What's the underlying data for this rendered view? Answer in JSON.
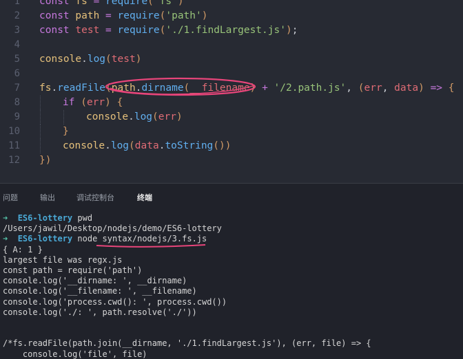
{
  "editor": {
    "lines": [
      {
        "num": "1",
        "text": "const fs = require('fs')"
      },
      {
        "num": "2",
        "text": "const path = require('path')"
      },
      {
        "num": "3",
        "text": "const test = require('./1.findLargest.js');"
      },
      {
        "num": "4",
        "text": ""
      },
      {
        "num": "5",
        "text": "console.log(test)"
      },
      {
        "num": "6",
        "text": ""
      },
      {
        "num": "7",
        "text": "fs.readFile(path.dirname(__filename) + '/2.path.js', (err, data) => {"
      },
      {
        "num": "8",
        "text": "if (err) {"
      },
      {
        "num": "9",
        "text": "console.log(err)"
      },
      {
        "num": "10",
        "text": "}"
      },
      {
        "num": "11",
        "text": "console.log(data.toString())"
      },
      {
        "num": "12",
        "text": "})"
      }
    ]
  },
  "panel": {
    "tabs": [
      {
        "label": "问题"
      },
      {
        "label": "输出"
      },
      {
        "label": "调试控制台"
      },
      {
        "label": "终端",
        "active": true
      }
    ]
  },
  "terminal": {
    "prompt_symbol": "➜",
    "lines": [
      {
        "type": "prompt",
        "dir": "ES6-lottery",
        "cmd": "pwd"
      },
      {
        "type": "out",
        "text": "/Users/jawil/Desktop/nodejs/demo/ES6-lottery"
      },
      {
        "type": "prompt",
        "dir": "ES6-lottery",
        "cmd": "node syntax/nodejs/3.fs.js"
      },
      {
        "type": "out",
        "text": "{ A: 1 }"
      },
      {
        "type": "out",
        "text": "largest file was regx.js"
      },
      {
        "type": "out",
        "text": "const path = require('path')"
      },
      {
        "type": "out",
        "text": "console.log('__dirname: ', __dirname)"
      },
      {
        "type": "out",
        "text": "console.log('__filename: ', __filename)"
      },
      {
        "type": "out",
        "text": "console.log('process.cwd(): ', process.cwd())"
      },
      {
        "type": "out",
        "text": "console.log('./: ', path.resolve('./'))"
      },
      {
        "type": "out",
        "text": ""
      },
      {
        "type": "out",
        "text": ""
      },
      {
        "type": "out",
        "text": "/*fs.readFile(path.join(__dirname, './1.findLargest.js'), (err, file) => {"
      },
      {
        "type": "out",
        "text": "    console.log('file', file)"
      },
      {
        "type": "out",
        "text": "})*/"
      }
    ]
  },
  "colors": {
    "editor_bg": "#272a33",
    "terminal_bg": "#20222a",
    "annotation": "#e8457a",
    "prompt_arrow": "#55c2a8",
    "prompt_dir": "#4aa9d6"
  }
}
